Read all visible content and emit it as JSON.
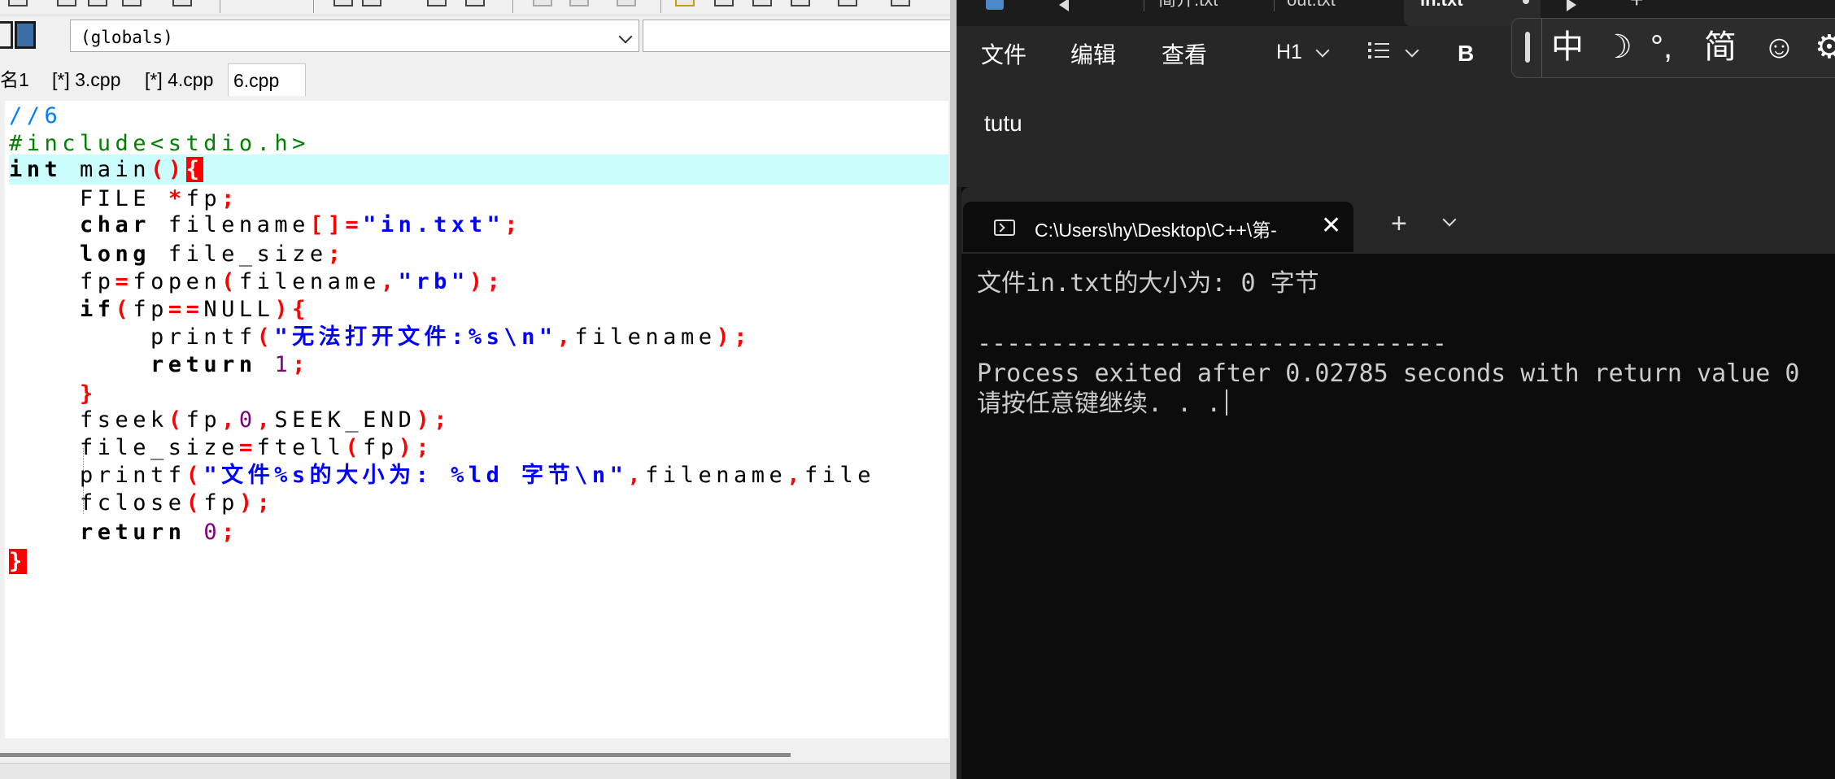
{
  "ide": {
    "scope_combo": "(globals)",
    "tabs": [
      "名1",
      "[*] 3.cpp",
      "[*] 4.cpp",
      "6.cpp"
    ],
    "code": [
      [
        [
          "//6",
          "cmt"
        ]
      ],
      [
        [
          "#include<stdio.h>",
          "pp"
        ]
      ],
      [
        [
          "int",
          "kw"
        ],
        [
          " main",
          "id"
        ],
        [
          "()",
          "op"
        ],
        [
          "{",
          "brace"
        ]
      ],
      [
        [
          "    FILE ",
          "id"
        ],
        [
          "*",
          "op"
        ],
        [
          "fp",
          "id"
        ],
        [
          ";",
          "op"
        ]
      ],
      [
        [
          "    ",
          "id"
        ],
        [
          "char",
          "kw"
        ],
        [
          " filename",
          "id"
        ],
        [
          "[]=",
          "op"
        ],
        [
          "\"in.txt\"",
          "str"
        ],
        [
          ";",
          "op"
        ]
      ],
      [
        [
          "    ",
          "id"
        ],
        [
          "long",
          "kw"
        ],
        [
          " file_size",
          "id"
        ],
        [
          ";",
          "op"
        ]
      ],
      [
        [
          "    fp",
          "id"
        ],
        [
          "=",
          "op"
        ],
        [
          "fopen",
          "id"
        ],
        [
          "(",
          "op"
        ],
        [
          "filename",
          "id"
        ],
        [
          ",",
          "op"
        ],
        [
          "\"rb\"",
          "str"
        ],
        [
          ");",
          "op"
        ]
      ],
      [
        [
          "    ",
          "id"
        ],
        [
          "if",
          "kw"
        ],
        [
          "(",
          "op"
        ],
        [
          "fp",
          "id"
        ],
        [
          "==",
          "op"
        ],
        [
          "NULL",
          "id"
        ],
        [
          "){",
          "op"
        ]
      ],
      [
        [
          "        printf",
          "id"
        ],
        [
          "(",
          "op"
        ],
        [
          "\"无法打开文件:%s\\n\"",
          "str"
        ],
        [
          ",",
          "op"
        ],
        [
          "filename",
          "id"
        ],
        [
          ");",
          "op"
        ]
      ],
      [
        [
          "        ",
          "id"
        ],
        [
          "return",
          "kw"
        ],
        [
          " ",
          "id"
        ],
        [
          "1",
          "num"
        ],
        [
          ";",
          "op"
        ]
      ],
      [
        [
          "    ",
          "id"
        ],
        [
          "}",
          "op"
        ]
      ],
      [
        [
          "    fseek",
          "id"
        ],
        [
          "(",
          "op"
        ],
        [
          "fp",
          "id"
        ],
        [
          ",",
          "op"
        ],
        [
          "0",
          "num"
        ],
        [
          ",",
          "op"
        ],
        [
          "SEEK_END",
          "id"
        ],
        [
          ");",
          "op"
        ]
      ],
      [
        [
          "    file_size",
          "id"
        ],
        [
          "=",
          "op"
        ],
        [
          "ftell",
          "id"
        ],
        [
          "(",
          "op"
        ],
        [
          "fp",
          "id"
        ],
        [
          ");",
          "op"
        ]
      ],
      [
        [
          "    printf",
          "id"
        ],
        [
          "(",
          "op"
        ],
        [
          "\"文件%s的大小为: %ld 字节\\n\"",
          "str"
        ],
        [
          ",",
          "op"
        ],
        [
          "filename",
          "id"
        ],
        [
          ",",
          "op"
        ],
        [
          "file",
          "id"
        ]
      ],
      [
        [
          "    fclose",
          "id"
        ],
        [
          "(",
          "op"
        ],
        [
          "fp",
          "id"
        ],
        [
          ");",
          "op"
        ]
      ],
      [
        [
          "    ",
          "id"
        ],
        [
          "return",
          "kw"
        ],
        [
          " ",
          "id"
        ],
        [
          "0",
          "num"
        ],
        [
          ";",
          "op"
        ]
      ],
      [
        [
          "}",
          "brace"
        ]
      ]
    ]
  },
  "notepad": {
    "tabs": [
      "简介.txt",
      "out.txt",
      "in.txt"
    ],
    "add_tab": "+",
    "menu": [
      "文件",
      "编辑",
      "查看"
    ],
    "heading_control": "H1",
    "bold_label": "B",
    "content": "tutu",
    "ime": {
      "mode": "中",
      "punct": "°,",
      "script": "简"
    }
  },
  "terminal": {
    "tab_title": "C:\\Users\\hy\\Desktop\\C++\\第-",
    "close_glyph": "✕",
    "new_tab_glyph": "+",
    "lines": [
      "文件in.txt的大小为: 0 字节",
      "",
      "--------------------------------",
      "Process exited after 0.02785 seconds with return value 0",
      "请按任意键继续. . ."
    ]
  }
}
